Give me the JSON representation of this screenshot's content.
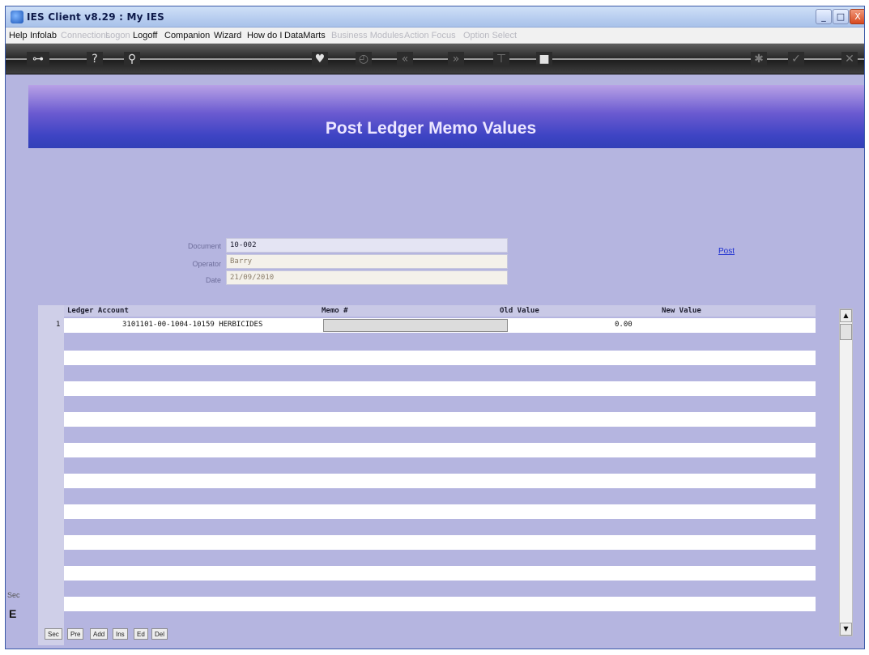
{
  "window": {
    "title": "IES Client v8.29 : My IES",
    "controls": {
      "minimize": "_",
      "maximize": "□",
      "close": "X"
    }
  },
  "menu": {
    "items": [
      {
        "label": "Help",
        "enabled": true
      },
      {
        "label": "Infolab",
        "enabled": true
      },
      {
        "label": "Connections",
        "enabled": false
      },
      {
        "label": "Logon",
        "enabled": false
      },
      {
        "label": "Logoff",
        "enabled": true
      },
      {
        "label": "Companion",
        "enabled": true
      },
      {
        "label": "Wizard",
        "enabled": true
      },
      {
        "label": "How do I",
        "enabled": true
      },
      {
        "label": "DataMarts",
        "enabled": true
      },
      {
        "label": "Business Modules",
        "enabled": false
      },
      {
        "label": "Action Focus",
        "enabled": false
      },
      {
        "label": "Option Select",
        "enabled": false
      }
    ]
  },
  "toolbar": {
    "icons": [
      "key-icon",
      "help-icon",
      "search-icon",
      "heart-icon",
      "clock-icon",
      "back-icon",
      "forward-icon",
      "pin-icon",
      "stop-icon",
      "settings-icon",
      "check-icon",
      "close-icon"
    ]
  },
  "page": {
    "title": "Post Ledger Memo Values"
  },
  "form": {
    "document_label": "Document",
    "document_value": "10-002",
    "operator_label": "Operator",
    "operator_value": "Barry",
    "date_label": "Date",
    "date_value": "21/09/2010",
    "post_link": "Post"
  },
  "grid": {
    "headers": {
      "ledger_account": "Ledger Account",
      "memo": "Memo #",
      "old_value": "Old Value",
      "new_value": "New Value"
    },
    "rows": [
      {
        "num": "1",
        "ledger_account": "3101101-00-1004-10159 HERBICIDES",
        "memo": "",
        "old_value": "0.00",
        "new_value": ""
      }
    ]
  },
  "bottom_buttons": [
    "Sec",
    "Pre",
    "Add",
    "Ins",
    "Ed",
    "Del"
  ],
  "side_stub": {
    "text_1": "Sec",
    "text_2": "E"
  }
}
